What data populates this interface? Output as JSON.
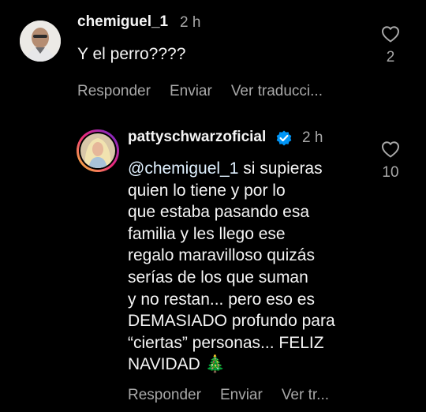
{
  "comment1": {
    "username": "chemiguel_1",
    "time": "2 h",
    "text": "Y el perro????",
    "likes": "2",
    "actions": {
      "reply": "Responder",
      "send": "Enviar",
      "translate": "Ver traducci..."
    }
  },
  "reply1": {
    "username": "pattyschwarzoficial",
    "verified": true,
    "time": "2 h",
    "mention": "@chemiguel_1",
    "lines": [
      " si supieras",
      "quien lo tiene y por lo",
      "que estaba pasando esa",
      "familia y les llego ese",
      "regalo maravilloso quizás",
      "serías de los que suman",
      "y no restan... pero eso es",
      "DEMASIADO profundo para",
      "“ciertas” personas... FELIZ",
      "NAVIDAD 🎄"
    ],
    "likes": "10",
    "actions": {
      "reply": "Responder",
      "send": "Enviar",
      "translate": "Ver tr..."
    }
  },
  "colors": {
    "background": "#000000",
    "primary_text": "#f5f5f5",
    "secondary_text": "#a8a8a8",
    "verified_badge": "#0095f6"
  },
  "icons": [
    "heart-icon",
    "verified-badge-icon",
    "christmas-tree-emoji"
  ]
}
